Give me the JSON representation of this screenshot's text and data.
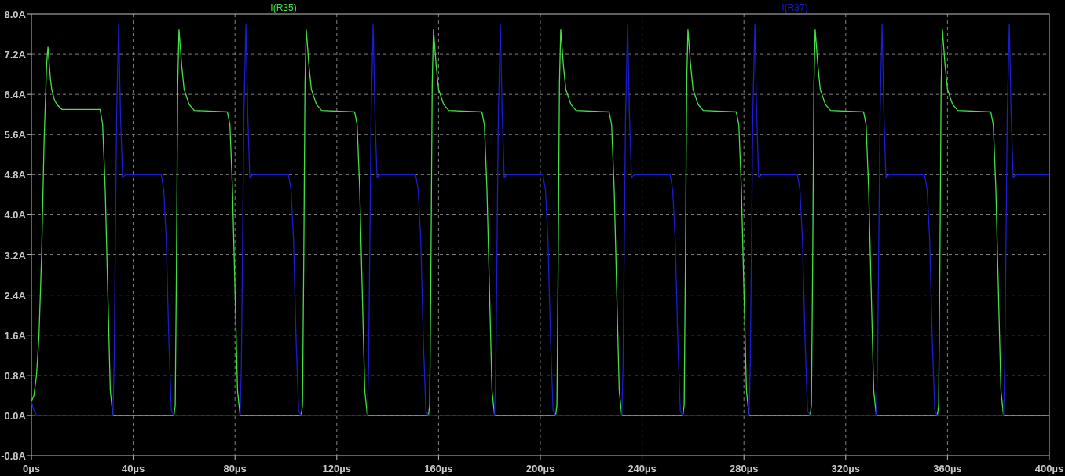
{
  "chart_data": {
    "type": "line",
    "grid": true,
    "xlim": [
      0,
      400
    ],
    "ylim": [
      -0.8,
      8.0
    ],
    "xticks": [
      {
        "value": 0,
        "label": "0µs"
      },
      {
        "value": 40,
        "label": "40µs"
      },
      {
        "value": 80,
        "label": "80µs"
      },
      {
        "value": 120,
        "label": "120µs"
      },
      {
        "value": 160,
        "label": "160µs"
      },
      {
        "value": 200,
        "label": "200µs"
      },
      {
        "value": 240,
        "label": "240µs"
      },
      {
        "value": 280,
        "label": "280µs"
      },
      {
        "value": 320,
        "label": "320µs"
      },
      {
        "value": 360,
        "label": "360µs"
      },
      {
        "value": 400,
        "label": "400µs"
      }
    ],
    "yticks": [
      {
        "value": 8.0,
        "label": "8.0A"
      },
      {
        "value": 7.2,
        "label": "7.2A"
      },
      {
        "value": 6.4,
        "label": "6.4A"
      },
      {
        "value": 5.6,
        "label": "5.6A"
      },
      {
        "value": 4.8,
        "label": "4.8A"
      },
      {
        "value": 4.0,
        "label": "4.0A"
      },
      {
        "value": 3.2,
        "label": "3.2A"
      },
      {
        "value": 2.4,
        "label": "2.4A"
      },
      {
        "value": 1.6,
        "label": "1.6A"
      },
      {
        "value": 0.8,
        "label": "0.8A"
      },
      {
        "value": 0.0,
        "label": "0.0A"
      },
      {
        "value": -0.8,
        "label": "-0.8A"
      }
    ],
    "x": [
      0,
      1,
      2,
      3,
      4,
      5,
      6,
      6.5,
      7,
      7.5,
      8,
      9,
      10,
      12,
      14,
      27,
      28,
      29,
      30,
      31,
      32,
      32.5,
      33.5,
      34.3,
      35,
      35.8,
      37,
      50,
      51,
      52,
      53,
      54,
      55,
      56,
      56.5,
      57,
      57.5,
      58,
      59,
      60,
      62,
      64,
      77,
      78,
      79,
      80,
      81,
      82,
      82.5,
      83.5,
      84.3,
      85,
      85.8,
      87,
      100,
      101,
      102,
      103,
      104,
      105,
      106,
      106.5,
      107,
      107.5,
      108,
      109,
      110,
      112,
      114,
      127,
      128,
      129,
      130,
      131,
      132,
      132.5,
      133.5,
      134.3,
      135,
      135.8,
      137,
      150,
      151,
      152,
      153,
      154,
      155,
      156,
      156.5,
      157,
      157.5,
      158,
      159,
      160,
      162,
      164,
      177,
      178,
      179,
      180,
      181,
      182,
      182.5,
      183.5,
      184.3,
      185,
      185.8,
      187,
      200,
      201,
      202,
      203,
      204,
      205,
      206,
      206.5,
      207,
      207.5,
      208,
      209,
      210,
      212,
      214,
      227,
      228,
      229,
      230,
      231,
      232,
      232.5,
      233.5,
      234.3,
      235,
      235.8,
      237,
      250,
      251,
      252,
      253,
      254,
      255,
      256,
      256.5,
      257,
      257.5,
      258,
      259,
      260,
      262,
      264,
      277,
      278,
      279,
      280,
      281,
      282,
      282.5,
      283.5,
      284.3,
      285,
      285.8,
      287,
      300,
      301,
      302,
      303,
      304,
      305,
      306,
      306.5,
      307,
      307.5,
      308,
      309,
      310,
      312,
      314,
      327,
      328,
      329,
      330,
      331,
      332,
      332.5,
      333.5,
      334.3,
      335,
      335.8,
      337,
      350,
      351,
      352,
      353,
      354,
      355,
      356,
      356.5,
      357,
      357.5,
      358,
      359,
      360,
      362,
      364,
      377,
      378,
      379,
      380,
      381,
      382,
      382.5,
      383.5,
      384.3,
      385,
      385.8,
      387,
      400
    ],
    "series": [
      {
        "name": "I(R35)",
        "color": "#44e044",
        "values": [
          0.28,
          0.4,
          0.8,
          1.6,
          3.2,
          5.5,
          7.0,
          7.35,
          7.0,
          6.7,
          6.5,
          6.3,
          6.2,
          6.1,
          6.1,
          6.1,
          5.8,
          4.5,
          2.5,
          0.5,
          0,
          0,
          0,
          0,
          0,
          0,
          0,
          0,
          0,
          0,
          0,
          0,
          0,
          0,
          0.2,
          3,
          6.6,
          7.7,
          7.0,
          6.5,
          6.2,
          6.08,
          6.05,
          5.8,
          4.5,
          2.5,
          0.5,
          0,
          0,
          0,
          0,
          0,
          0,
          0,
          0,
          0,
          0,
          0,
          0,
          0,
          0,
          0.2,
          3,
          6.6,
          7.7,
          7.0,
          6.5,
          6.2,
          6.08,
          6.05,
          5.8,
          4.5,
          2.5,
          0.5,
          0,
          0,
          0,
          0,
          0,
          0,
          0,
          0,
          0,
          0,
          0,
          0,
          0,
          0,
          0.2,
          3,
          6.6,
          7.7,
          7.0,
          6.5,
          6.2,
          6.08,
          6.05,
          5.8,
          4.5,
          2.5,
          0.5,
          0,
          0,
          0,
          0,
          0,
          0,
          0,
          0,
          0,
          0,
          0,
          0,
          0,
          0,
          0.2,
          3,
          6.6,
          7.7,
          7.0,
          6.5,
          6.2,
          6.08,
          6.05,
          5.8,
          4.5,
          2.5,
          0.5,
          0,
          0,
          0,
          0,
          0,
          0,
          0,
          0,
          0,
          0,
          0,
          0,
          0,
          0,
          0.2,
          3,
          6.6,
          7.7,
          7.0,
          6.5,
          6.2,
          6.08,
          6.05,
          5.8,
          4.5,
          2.5,
          0.5,
          0,
          0,
          0,
          0,
          0,
          0,
          0,
          0,
          0,
          0,
          0,
          0,
          0,
          0,
          0.2,
          3,
          6.6,
          7.7,
          7.0,
          6.5,
          6.2,
          6.08,
          6.05,
          5.8,
          4.5,
          2.5,
          0.5,
          0,
          0,
          0,
          0,
          0,
          0,
          0,
          0,
          0,
          0,
          0,
          0,
          0,
          0,
          0.2,
          3,
          6.6,
          7.7,
          7.0,
          6.5,
          6.2,
          6.08,
          6.05,
          5.8,
          4.5,
          2.5,
          0.5,
          0,
          0,
          0,
          0,
          0,
          0,
          0,
          0
        ]
      },
      {
        "name": "I(R37)",
        "color": "#1c1cd0",
        "values": [
          0.28,
          0.1,
          0,
          0,
          0,
          0,
          0,
          0,
          0,
          0,
          0,
          0,
          0,
          0,
          0,
          0,
          0,
          0,
          0,
          0,
          0,
          1.0,
          6,
          7.8,
          6,
          4.75,
          4.8,
          4.8,
          4.8,
          4.5,
          3.5,
          1.5,
          0.1,
          0,
          0,
          0,
          0,
          0,
          0,
          0,
          0,
          0,
          0,
          0,
          0,
          0,
          0,
          0,
          1.0,
          6,
          7.8,
          6,
          4.75,
          4.8,
          4.8,
          4.8,
          4.5,
          3.5,
          1.5,
          0.1,
          0,
          0,
          0,
          0,
          0,
          0,
          0,
          0,
          0,
          0,
          0,
          0,
          0,
          0,
          0,
          1.0,
          6,
          7.8,
          6,
          4.75,
          4.8,
          4.8,
          4.8,
          4.5,
          3.5,
          1.5,
          0.1,
          0,
          0,
          0,
          0,
          0,
          0,
          0,
          0,
          0,
          0,
          0,
          0,
          0,
          0,
          0,
          1.0,
          6,
          7.8,
          6,
          4.75,
          4.8,
          4.8,
          4.8,
          4.5,
          3.5,
          1.5,
          0.1,
          0,
          0,
          0,
          0,
          0,
          0,
          0,
          0,
          0,
          0,
          0,
          0,
          0,
          0,
          0,
          1.0,
          6,
          7.8,
          6,
          4.75,
          4.8,
          4.8,
          4.8,
          4.5,
          3.5,
          1.5,
          0.1,
          0,
          0,
          0,
          0,
          0,
          0,
          0,
          0,
          0,
          0,
          0,
          0,
          0,
          0,
          0,
          1.0,
          6,
          7.8,
          6,
          4.75,
          4.8,
          4.8,
          4.8,
          4.5,
          3.5,
          1.5,
          0.1,
          0,
          0,
          0,
          0,
          0,
          0,
          0,
          0,
          0,
          0,
          0,
          0,
          0,
          0,
          0,
          1.0,
          6,
          7.8,
          6,
          4.75,
          4.8,
          4.8,
          4.8,
          4.5,
          3.5,
          1.5,
          0.1,
          0,
          0,
          0,
          0,
          0,
          0,
          0,
          0,
          0,
          0,
          0,
          0,
          0,
          0,
          0,
          1.0,
          6,
          7.8,
          6,
          4.75,
          4.8,
          4.8
        ]
      }
    ]
  }
}
